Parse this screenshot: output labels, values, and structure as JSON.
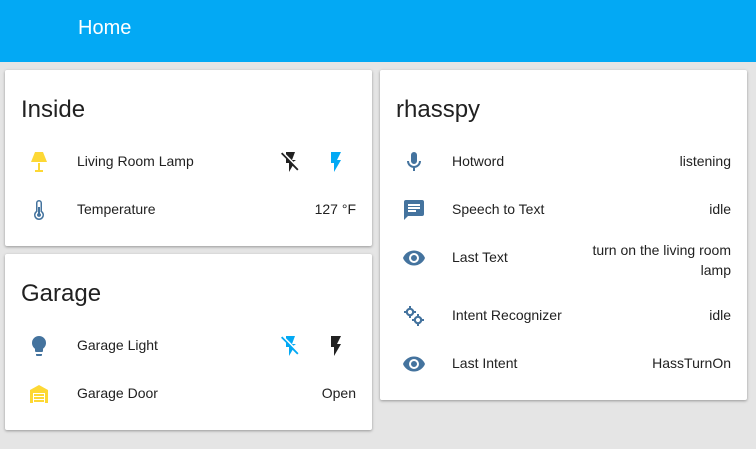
{
  "header": {
    "title": "Home"
  },
  "colors": {
    "toolbar": "#03a9f4",
    "on_yellow": "#fdd835",
    "off_blue": "#44739e",
    "active_blue": "#03a9f4",
    "inactive_dark": "#212121"
  },
  "cards": {
    "inside": {
      "title": "Inside",
      "rows": [
        {
          "label": "Living Room Lamp",
          "icon": "floor-lamp-icon"
        },
        {
          "label": "Temperature",
          "value": "127 °F",
          "icon": "thermometer-icon"
        }
      ]
    },
    "garage": {
      "title": "Garage",
      "rows": [
        {
          "label": "Garage Light",
          "icon": "lightbulb-icon"
        },
        {
          "label": "Garage Door",
          "value": "Open",
          "icon": "garage-open-icon"
        }
      ]
    },
    "rhasspy": {
      "title": "rhasspy",
      "rows": [
        {
          "label": "Hotword",
          "value": "listening",
          "icon": "microphone-icon"
        },
        {
          "label": "Speech to Text",
          "value": "idle",
          "icon": "message-text-icon"
        },
        {
          "label": "Last Text",
          "value": "turn on the living room lamp",
          "icon": "eye-icon"
        },
        {
          "label": "Intent Recognizer",
          "value": "idle",
          "icon": "settings-icon"
        },
        {
          "label": "Last Intent",
          "value": "HassTurnOn",
          "icon": "eye-icon"
        }
      ]
    }
  }
}
